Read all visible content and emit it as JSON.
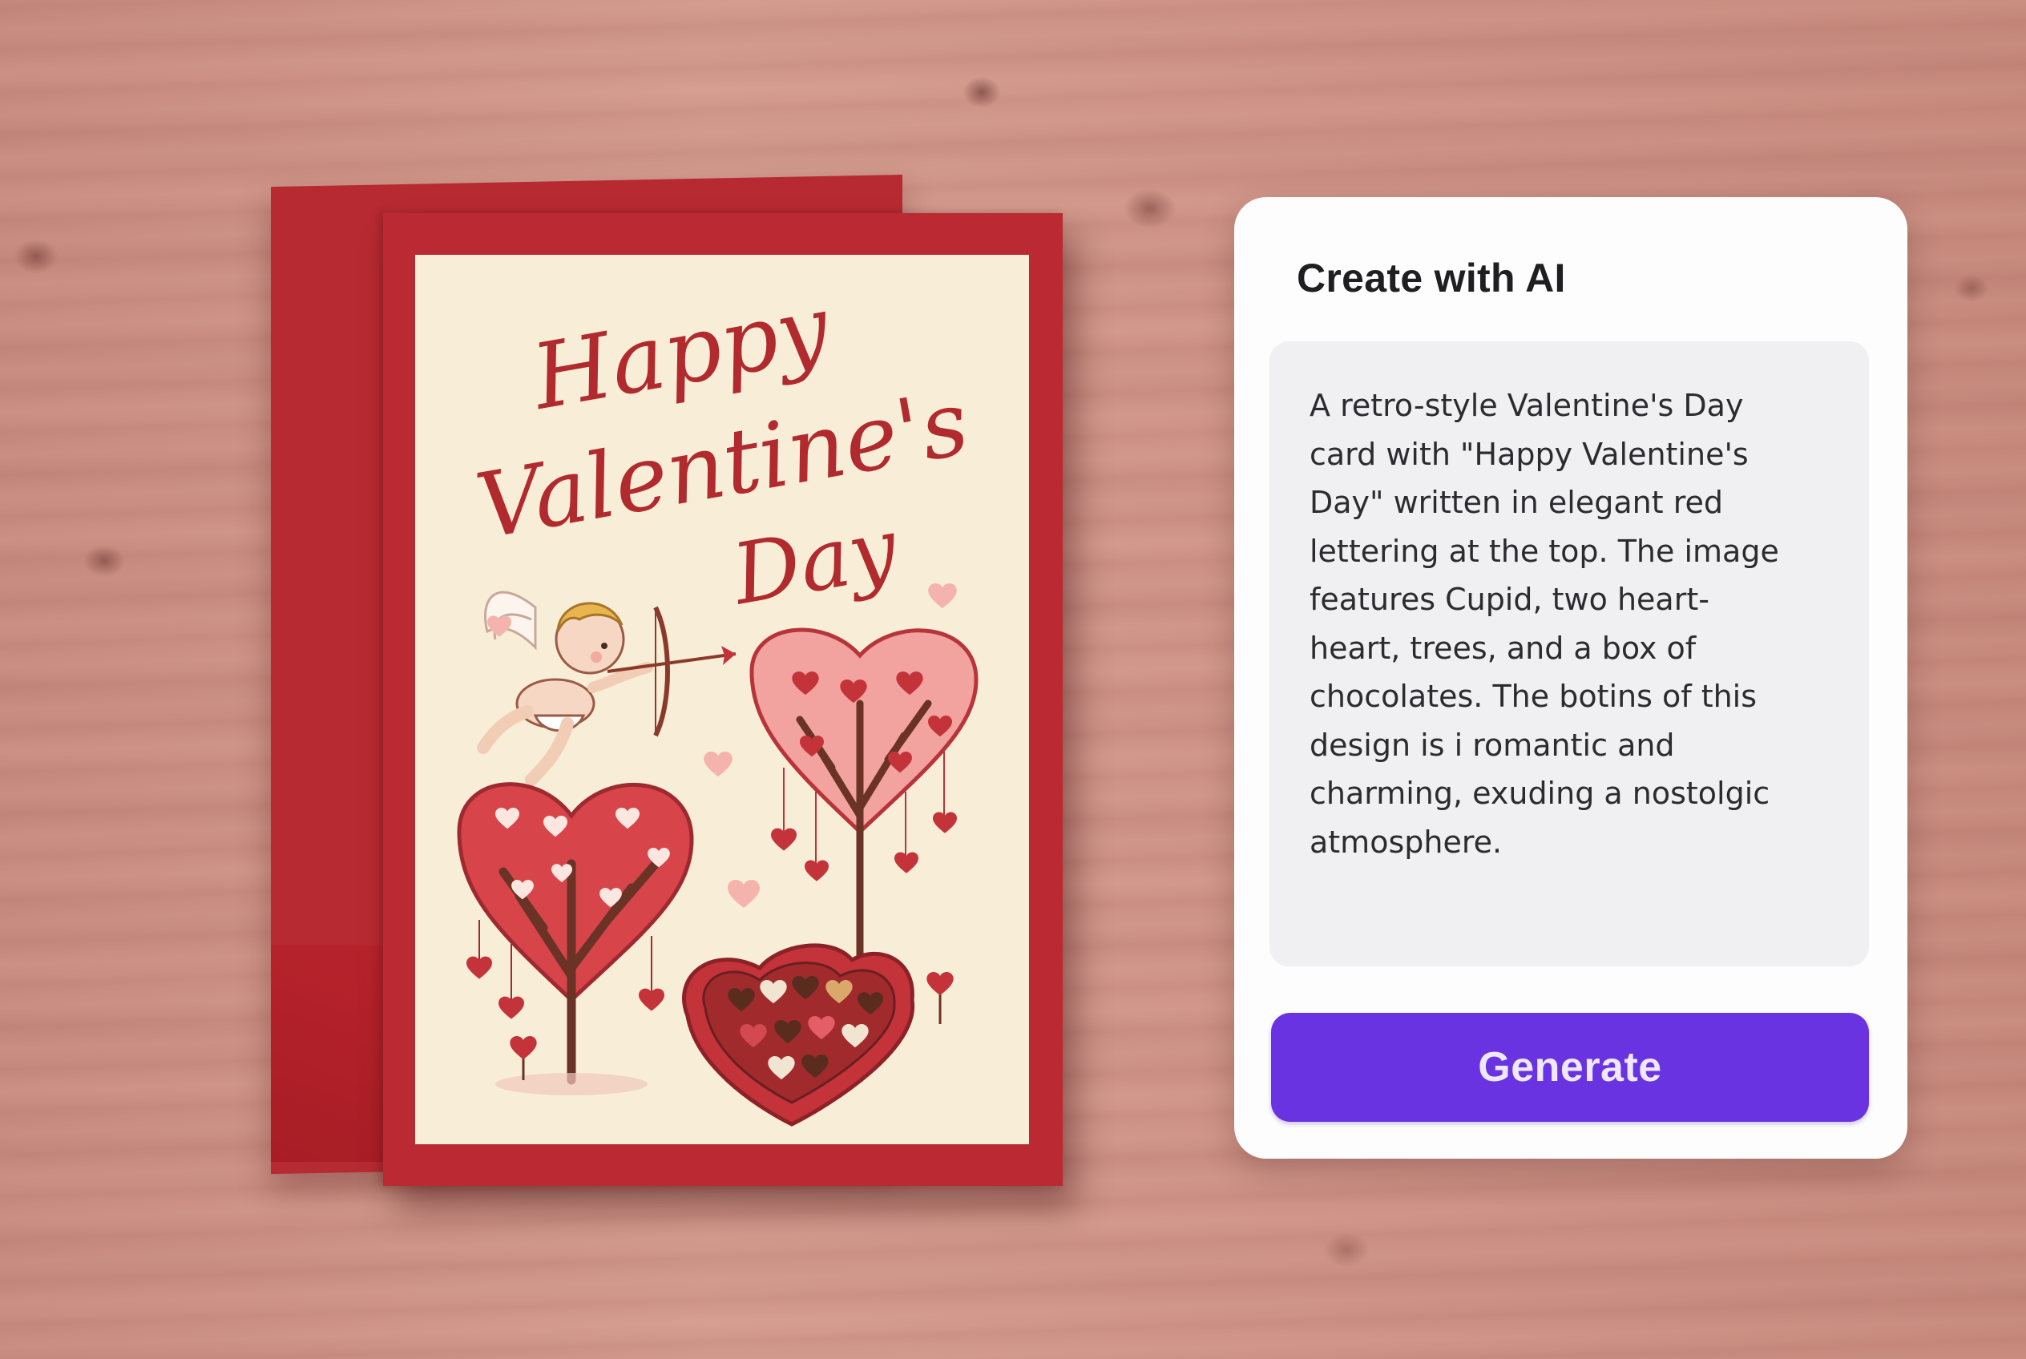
{
  "card": {
    "title_line1": "Happy",
    "title_line2": "Valentine's",
    "title_line3": "Day"
  },
  "ai_panel": {
    "title": "Create with AI",
    "prompt_text": "A retro-style Valentine's Day\ncard with \"Happy Valentine's\nDay\" written in elegant red\nlettering at the top. The image\nfeatures Cupid, two heart-\nheart, trees, and a box of\nchocolates. The botins of this\ndesign is i  romantic and\ncharming, exuding a nostolgic\natmosphere.",
    "generate_label": "Generate"
  },
  "colors": {
    "accent": "#6a33e2",
    "card_red": "#bb2a32",
    "card_cream": "#f8eed8",
    "wood": "#d39b8e"
  }
}
